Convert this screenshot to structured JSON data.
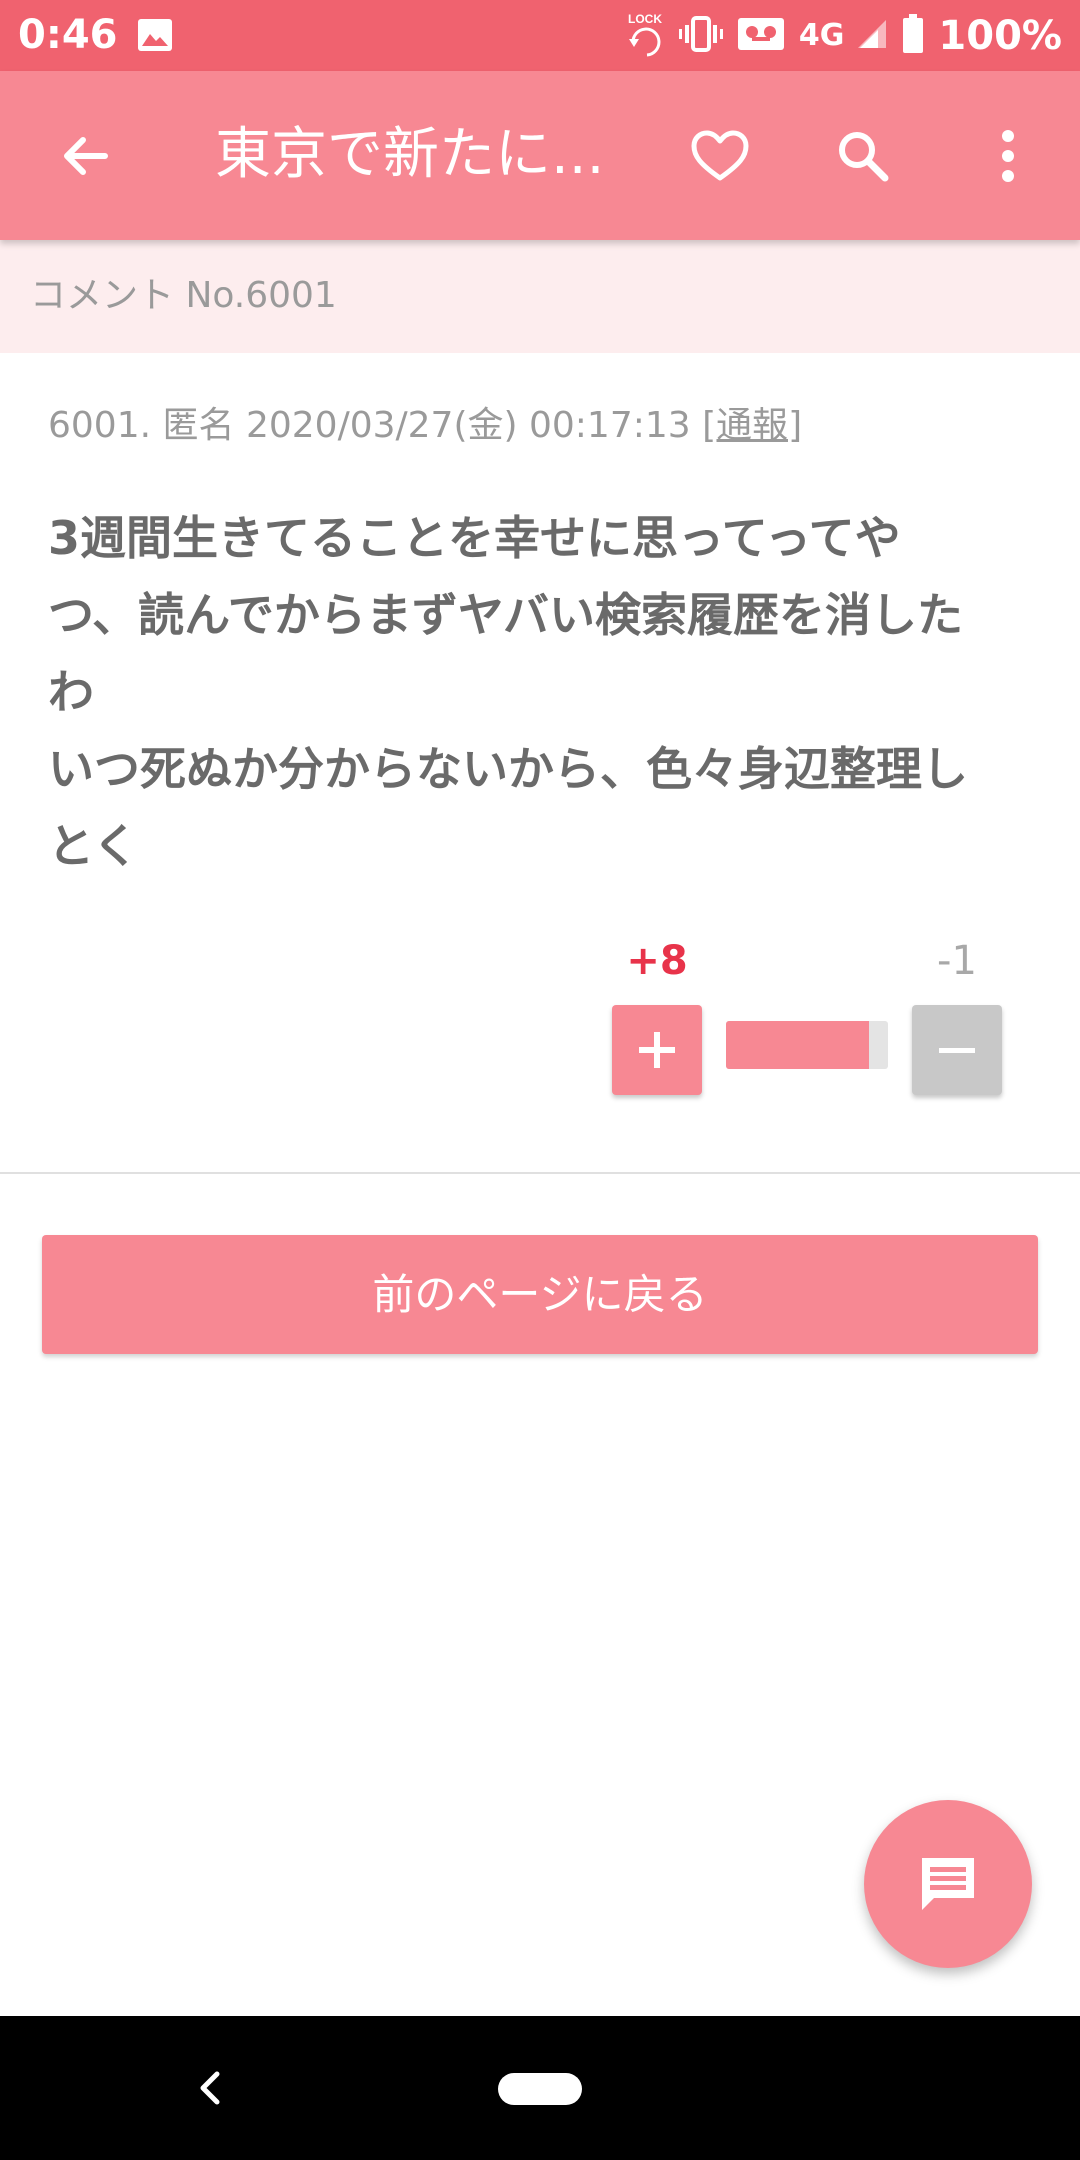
{
  "status_bar": {
    "time": "0:46",
    "network": "4G",
    "battery": "100%",
    "icons": [
      "image-icon",
      "lock-rotation-icon",
      "vibrate-icon",
      "voicemail-icon",
      "signal-icon",
      "battery-icon"
    ]
  },
  "app_bar": {
    "title": "東京で新たに...",
    "icons": [
      "back-arrow-icon",
      "heart-icon",
      "search-icon",
      "more-vert-icon"
    ]
  },
  "comment_strip": {
    "label": "コメント No.6001"
  },
  "comment": {
    "meta": "6001. 匿名 2020/03/27(金) 00:17:13 ",
    "report_label": "[通報]",
    "lines": [
      "3週間生きてることを幸せに思ってってや",
      "つ、読んでからまずヤバい検索履歴を消した",
      "わ",
      "いつ死ぬか分からないから、色々身辺整理し",
      "とく"
    ]
  },
  "votes": {
    "plus_count": "+8",
    "minus_count": "-1",
    "positive_ratio": 0.88,
    "plus_symbol": "+",
    "minus_symbol": "—"
  },
  "prev_page_button": {
    "label": "前のページに戻る"
  },
  "fab": {
    "icon": "comment-icon"
  },
  "colors": {
    "status_bar": "#f0626f",
    "app_bar": "#f78893",
    "accent": "#f78893",
    "strip_bg": "#fdedee",
    "plus_text": "#e8334a",
    "minus_button": "#c8c8c8"
  }
}
